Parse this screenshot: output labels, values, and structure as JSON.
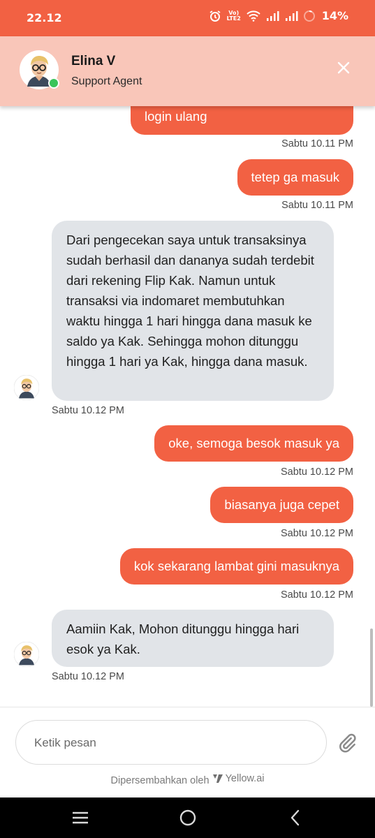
{
  "status_bar": {
    "time": "22.12",
    "volte_label": "Vo) LTE2",
    "battery": "14%"
  },
  "header": {
    "agent_name": "Elina V",
    "agent_role": "Support Agent"
  },
  "messages": [
    {
      "text": "login ulang",
      "time": "Sabtu 10.11 PM",
      "from": "user"
    },
    {
      "text": "tetep ga masuk",
      "time": "Sabtu 10.11 PM",
      "from": "user"
    },
    {
      "text": "Dari pengecekan saya untuk transaksinya sudah berhasil dan dananya sudah terdebit dari rekening Flip Kak. Namun untuk transaksi via indomaret membutuhkan waktu hingga 1 hari hingga dana masuk ke saldo ya Kak. Sehingga mohon ditunggu hingga 1 hari ya Kak, hingga dana masuk.",
      "time": "Sabtu 10.12 PM",
      "from": "agent"
    },
    {
      "text": "oke, semoga besok masuk ya",
      "time": "Sabtu 10.12 PM",
      "from": "user"
    },
    {
      "text": "biasanya juga cepet",
      "time": "Sabtu 10.12 PM",
      "from": "user"
    },
    {
      "text": "kok sekarang lambat gini masuknya",
      "time": "Sabtu 10.12 PM",
      "from": "user"
    },
    {
      "text": "Aamiin Kak, Mohon ditunggu hingga hari esok ya Kak.",
      "time": "Sabtu 10.12 PM",
      "from": "agent"
    }
  ],
  "composer": {
    "placeholder": "Ketik pesan",
    "value": ""
  },
  "footer": {
    "powered_by": "Dipersembahkan oleh",
    "brand": "Yellow.ai"
  },
  "colors": {
    "accent": "#f26143",
    "header_bg": "#f9c6b9",
    "agent_bubble": "#e1e4e8",
    "online": "#3ac45a"
  },
  "icons": [
    "alarm-icon",
    "volte-icon",
    "wifi-icon",
    "signal-icon",
    "battery-icon",
    "close-icon",
    "attachment-icon",
    "menu-nav-icon",
    "home-nav-icon",
    "back-nav-icon"
  ]
}
